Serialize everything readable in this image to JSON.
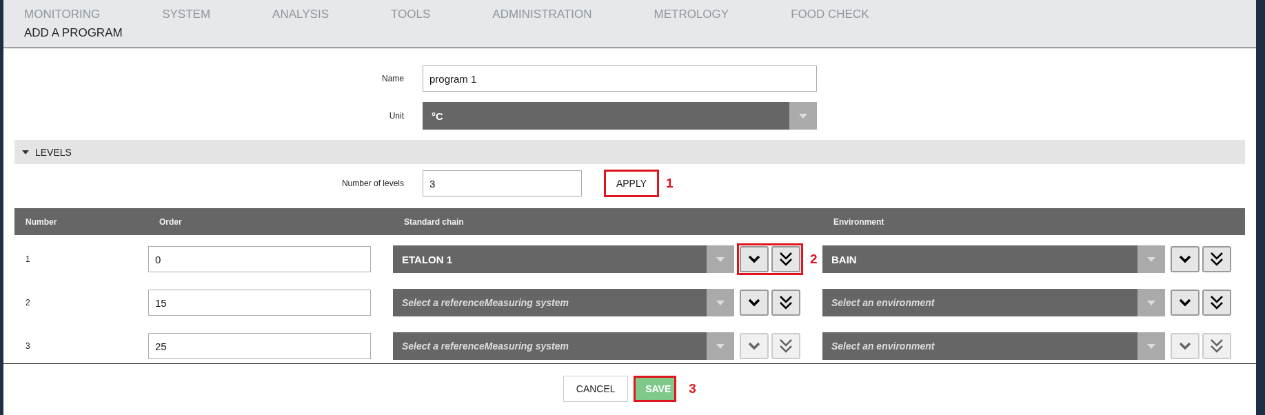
{
  "background_nav": [
    "MONITORING",
    "SYSTEM",
    "ANALYSIS",
    "TOOLS",
    "ADMINISTRATION",
    "METROLOGY",
    "FOOD CHECK"
  ],
  "dialog": {
    "title": "ADD A PROGRAM"
  },
  "form": {
    "name_label": "Name",
    "name_value": "program 1",
    "unit_label": "Unit",
    "unit_value": "°C"
  },
  "levels": {
    "title": "LEVELS",
    "expanded": true,
    "count_label": "Number of levels",
    "count_value": "3",
    "apply": {
      "label": "APPLY",
      "highlighted": true,
      "callout": "1"
    }
  },
  "table": {
    "columns": [
      "Number",
      "Order",
      "Standard chain",
      "Environment"
    ],
    "rows": [
      {
        "number": "1",
        "order": "0",
        "chain": {
          "text": "ETALON 1",
          "placeholder": false
        },
        "chain_buttons": {
          "disabled": false,
          "highlighted": true,
          "callout": "2"
        },
        "environment": {
          "text": "BAIN",
          "placeholder": false
        },
        "env_buttons": {
          "disabled": false
        }
      },
      {
        "number": "2",
        "order": "15",
        "chain": {
          "text": "Select a referenceMeasuring system",
          "placeholder": true
        },
        "chain_buttons": {
          "disabled": false,
          "highlighted": false
        },
        "environment": {
          "text": "Select an environment",
          "placeholder": true
        },
        "env_buttons": {
          "disabled": false
        }
      },
      {
        "number": "3",
        "order": "25",
        "chain": {
          "text": "Select a referenceMeasuring system",
          "placeholder": true
        },
        "chain_buttons": {
          "disabled": true,
          "highlighted": false
        },
        "environment": {
          "text": "Select an environment",
          "placeholder": true
        },
        "env_buttons": {
          "disabled": true
        }
      }
    ]
  },
  "footer": {
    "cancel": {
      "label": "CANCEL"
    },
    "save": {
      "label": "SAVE",
      "highlighted": true,
      "callout": "3"
    }
  }
}
